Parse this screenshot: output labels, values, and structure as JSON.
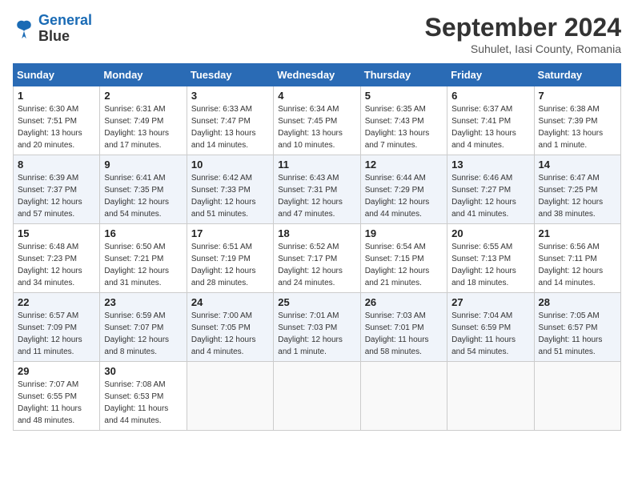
{
  "header": {
    "logo_line1": "General",
    "logo_line2": "Blue",
    "month": "September 2024",
    "location": "Suhulet, Iasi County, Romania"
  },
  "days_of_week": [
    "Sunday",
    "Monday",
    "Tuesday",
    "Wednesday",
    "Thursday",
    "Friday",
    "Saturday"
  ],
  "weeks": [
    [
      {
        "day": "1",
        "sunrise": "6:30 AM",
        "sunset": "7:51 PM",
        "daylight": "13 hours and 20 minutes."
      },
      {
        "day": "2",
        "sunrise": "6:31 AM",
        "sunset": "7:49 PM",
        "daylight": "13 hours and 17 minutes."
      },
      {
        "day": "3",
        "sunrise": "6:33 AM",
        "sunset": "7:47 PM",
        "daylight": "13 hours and 14 minutes."
      },
      {
        "day": "4",
        "sunrise": "6:34 AM",
        "sunset": "7:45 PM",
        "daylight": "13 hours and 10 minutes."
      },
      {
        "day": "5",
        "sunrise": "6:35 AM",
        "sunset": "7:43 PM",
        "daylight": "13 hours and 7 minutes."
      },
      {
        "day": "6",
        "sunrise": "6:37 AM",
        "sunset": "7:41 PM",
        "daylight": "13 hours and 4 minutes."
      },
      {
        "day": "7",
        "sunrise": "6:38 AM",
        "sunset": "7:39 PM",
        "daylight": "13 hours and 1 minute."
      }
    ],
    [
      {
        "day": "8",
        "sunrise": "6:39 AM",
        "sunset": "7:37 PM",
        "daylight": "12 hours and 57 minutes."
      },
      {
        "day": "9",
        "sunrise": "6:41 AM",
        "sunset": "7:35 PM",
        "daylight": "12 hours and 54 minutes."
      },
      {
        "day": "10",
        "sunrise": "6:42 AM",
        "sunset": "7:33 PM",
        "daylight": "12 hours and 51 minutes."
      },
      {
        "day": "11",
        "sunrise": "6:43 AM",
        "sunset": "7:31 PM",
        "daylight": "12 hours and 47 minutes."
      },
      {
        "day": "12",
        "sunrise": "6:44 AM",
        "sunset": "7:29 PM",
        "daylight": "12 hours and 44 minutes."
      },
      {
        "day": "13",
        "sunrise": "6:46 AM",
        "sunset": "7:27 PM",
        "daylight": "12 hours and 41 minutes."
      },
      {
        "day": "14",
        "sunrise": "6:47 AM",
        "sunset": "7:25 PM",
        "daylight": "12 hours and 38 minutes."
      }
    ],
    [
      {
        "day": "15",
        "sunrise": "6:48 AM",
        "sunset": "7:23 PM",
        "daylight": "12 hours and 34 minutes."
      },
      {
        "day": "16",
        "sunrise": "6:50 AM",
        "sunset": "7:21 PM",
        "daylight": "12 hours and 31 minutes."
      },
      {
        "day": "17",
        "sunrise": "6:51 AM",
        "sunset": "7:19 PM",
        "daylight": "12 hours and 28 minutes."
      },
      {
        "day": "18",
        "sunrise": "6:52 AM",
        "sunset": "7:17 PM",
        "daylight": "12 hours and 24 minutes."
      },
      {
        "day": "19",
        "sunrise": "6:54 AM",
        "sunset": "7:15 PM",
        "daylight": "12 hours and 21 minutes."
      },
      {
        "day": "20",
        "sunrise": "6:55 AM",
        "sunset": "7:13 PM",
        "daylight": "12 hours and 18 minutes."
      },
      {
        "day": "21",
        "sunrise": "6:56 AM",
        "sunset": "7:11 PM",
        "daylight": "12 hours and 14 minutes."
      }
    ],
    [
      {
        "day": "22",
        "sunrise": "6:57 AM",
        "sunset": "7:09 PM",
        "daylight": "12 hours and 11 minutes."
      },
      {
        "day": "23",
        "sunrise": "6:59 AM",
        "sunset": "7:07 PM",
        "daylight": "12 hours and 8 minutes."
      },
      {
        "day": "24",
        "sunrise": "7:00 AM",
        "sunset": "7:05 PM",
        "daylight": "12 hours and 4 minutes."
      },
      {
        "day": "25",
        "sunrise": "7:01 AM",
        "sunset": "7:03 PM",
        "daylight": "12 hours and 1 minute."
      },
      {
        "day": "26",
        "sunrise": "7:03 AM",
        "sunset": "7:01 PM",
        "daylight": "11 hours and 58 minutes."
      },
      {
        "day": "27",
        "sunrise": "7:04 AM",
        "sunset": "6:59 PM",
        "daylight": "11 hours and 54 minutes."
      },
      {
        "day": "28",
        "sunrise": "7:05 AM",
        "sunset": "6:57 PM",
        "daylight": "11 hours and 51 minutes."
      }
    ],
    [
      {
        "day": "29",
        "sunrise": "7:07 AM",
        "sunset": "6:55 PM",
        "daylight": "11 hours and 48 minutes."
      },
      {
        "day": "30",
        "sunrise": "7:08 AM",
        "sunset": "6:53 PM",
        "daylight": "11 hours and 44 minutes."
      },
      null,
      null,
      null,
      null,
      null
    ]
  ]
}
